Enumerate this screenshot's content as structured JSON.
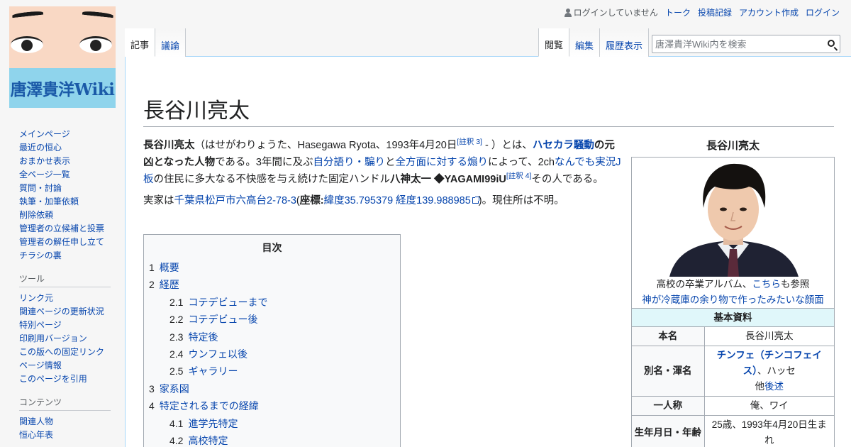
{
  "logo": {
    "text": "唐澤貴洋Wiki"
  },
  "sidebar": {
    "nav": [
      "メインページ",
      "最近の恒心",
      "おまかせ表示",
      "全ページ一覧",
      "質問・討論",
      "執筆・加筆依頼",
      "削除依頼",
      "管理者の立候補と投票",
      "管理者の解任申し立て",
      "チラシの裏"
    ],
    "tools_heading": "ツール",
    "tools": [
      "リンク元",
      "関連ページの更新状況",
      "特別ページ",
      "印刷用バージョン",
      "この版への固定リンク",
      "ページ情報",
      "このページを引用"
    ],
    "contents_heading": "コンテンツ",
    "contents": [
      "関連人物",
      "恒心年表"
    ]
  },
  "personal": {
    "not_logged_in": "ログインしていません",
    "talk": "トーク",
    "contributions": "投稿記録",
    "create_account": "アカウント作成",
    "login": "ログイン"
  },
  "tabs": {
    "article": "記事",
    "discussion": "議論",
    "read": "閲覧",
    "edit": "編集",
    "history": "履歴表示"
  },
  "search": {
    "placeholder": "唐澤貴洋Wiki内を検索"
  },
  "article": {
    "title": "長谷川亮太",
    "p1": {
      "bold_name": "長谷川亮太",
      "t1": "（はせがわりょうた、Hasegawa Ryota、1993年4月20日",
      "note3": "[註釈 3]",
      "t2": " - ）とは、",
      "link_incident": "ハセカラ騒動",
      "bold_culprit": "の元凶となった人物",
      "t3": "である。3年間に及ぶ",
      "link_self": "自分語り",
      "sep": "・",
      "link_fake": "騙り",
      "t4": "と",
      "link_flame": "全方面に対する煽り",
      "t5": "によって、2ch",
      "link_board": "なんでも実況J板",
      "t6": "の住民に多大なる不快感を与え続けた固定ハンドル",
      "bold_handle": "八神太一 ◆YAGAMI99iU",
      "note4": "[註釈 4]",
      "t7": "その人である。"
    },
    "p2": {
      "t1": "実家は",
      "link_addr": "千葉県松戸市六高台2-78-3",
      "t2": "(",
      "coord_label": "座標:",
      "coord": "緯度35.795379 経度139.988985",
      "t3": ")。現住所は不明。"
    }
  },
  "toc": {
    "title": "目次",
    "items": [
      {
        "num": "1",
        "text": "概要",
        "sub": false
      },
      {
        "num": "2",
        "text": "経歴",
        "sub": false
      },
      {
        "num": "2.1",
        "text": "コテデビューまで",
        "sub": true
      },
      {
        "num": "2.2",
        "text": "コテデビュー後",
        "sub": true
      },
      {
        "num": "2.3",
        "text": "特定後",
        "sub": true
      },
      {
        "num": "2.4",
        "text": "ウンフェ以後",
        "sub": true
      },
      {
        "num": "2.5",
        "text": "ギャラリー",
        "sub": true
      },
      {
        "num": "3",
        "text": "家系図",
        "sub": false
      },
      {
        "num": "4",
        "text": "特定されるまでの経緯",
        "sub": false
      },
      {
        "num": "4.1",
        "text": "進学先特定",
        "sub": true
      },
      {
        "num": "4.2",
        "text": "高校特定",
        "sub": true
      }
    ]
  },
  "infobox": {
    "title": "長谷川亮太",
    "caption_t1": "高校の卒業アルバム、",
    "caption_link": "こちら",
    "caption_t2": "も参照",
    "caption_link2": "神が冷蔵庫の余り物で作ったみたいな顔面",
    "section": "基本資料",
    "rows": {
      "name_k": "本名",
      "name_v": "長谷川亮太",
      "alias_k": "別名・渾名",
      "alias_link": "チンフェ（チンコフェイス）",
      "alias_t": "、ハッセ",
      "alias_other": "他",
      "alias_more": "後述",
      "pronoun_k": "一人称",
      "pronoun_v": "俺、ワイ",
      "dob_k": "生年月日・年齢",
      "dob_v": "25歳、1993年4月20日生まれ"
    }
  }
}
